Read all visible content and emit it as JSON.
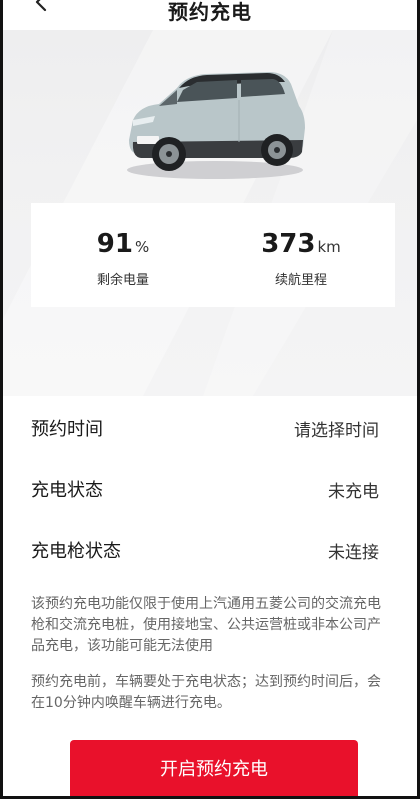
{
  "header": {
    "title": "预约充电",
    "back_icon": "chevron-left-icon"
  },
  "vehicle": {
    "image": "car-image",
    "body_color": "#b9c6c9"
  },
  "stats": {
    "battery_value": "91",
    "battery_unit": "%",
    "battery_label": "剩余电量",
    "range_value": "373",
    "range_unit": "km",
    "range_label": "续航里程"
  },
  "settings": {
    "rows": [
      {
        "label": "预约时间",
        "value": "请选择时间"
      },
      {
        "label": "充电状态",
        "value": "未充电"
      },
      {
        "label": "充电枪状态",
        "value": "未连接"
      }
    ]
  },
  "notes": [
    "该预约充电功能仅限于使用上汽通用五菱公司的交流充电枪和交流充电桩，使用接地宝、公共运营桩或非本公司产品充电，该功能可能无法使用",
    "预约充电前，车辆要处于充电状态；达到预约时间后，会在10分钟内唤醒车辆进行充电。"
  ],
  "action": {
    "button_label": "开启预约充电"
  },
  "colors": {
    "accent": "#e9112b",
    "hero_bg": "#f0f0f1"
  }
}
